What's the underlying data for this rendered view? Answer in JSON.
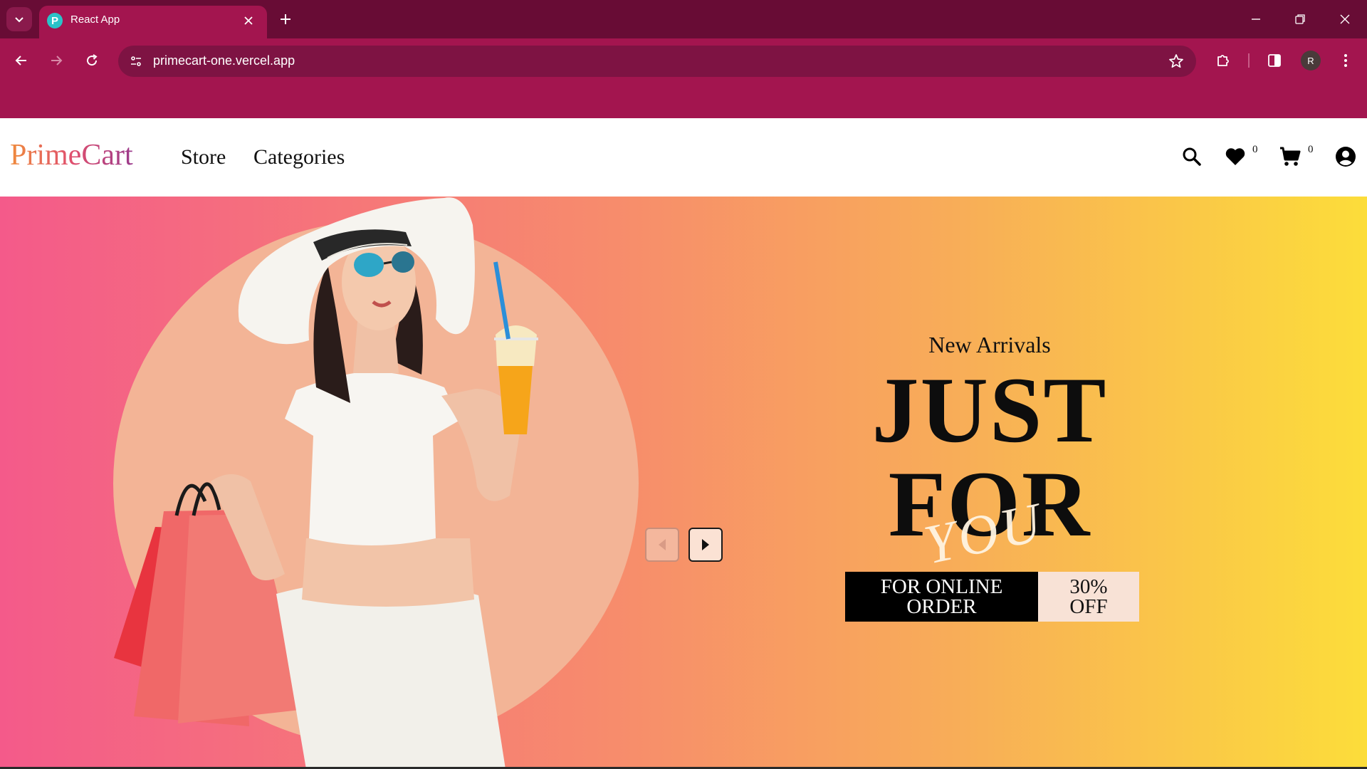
{
  "browser": {
    "tab_title": "React App",
    "tab_favicon_letter": "P",
    "url": "primecart-one.vercel.app",
    "profile_initial": "R",
    "theme_colors": {
      "tabstrip": "#680c35",
      "toolbar": "#a3154f",
      "omnibox": "#7e1343"
    }
  },
  "site": {
    "logo": "PrimeCart",
    "nav": [
      "Store",
      "Categories"
    ],
    "wishlist_count": "0",
    "cart_count": "0",
    "icons": [
      "search-icon",
      "heart-icon",
      "cart-icon",
      "account-icon"
    ]
  },
  "hero": {
    "eyebrow": "New Arrivals",
    "headline_line1": "JUST",
    "headline_line2": "FOR",
    "script_word": "YOU",
    "promo_left": "FOR ONLINE ORDER",
    "promo_right": "30% OFF",
    "gradient": [
      "#f45a8a",
      "#f78c6c",
      "#f8ad58",
      "#fcdd3a"
    ]
  }
}
